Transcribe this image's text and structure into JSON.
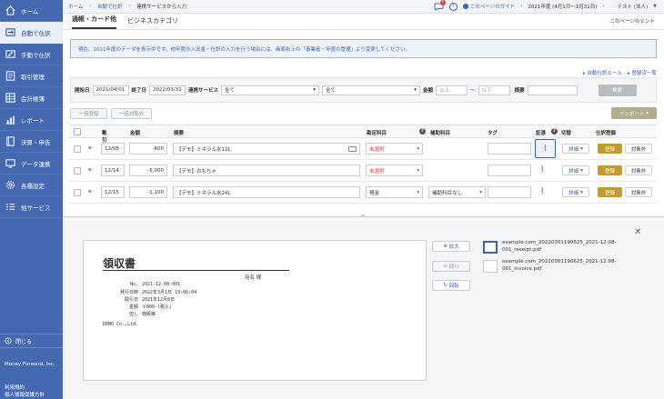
{
  "sidebar": {
    "items": [
      {
        "label": "ホーム",
        "icon": "home-icon"
      },
      {
        "label": "自動で仕訳",
        "icon": "auto-journal-icon",
        "active": true
      },
      {
        "label": "手動で仕訳",
        "icon": "manual-journal-icon"
      },
      {
        "label": "取引管理",
        "icon": "transaction-icon"
      },
      {
        "label": "会計帳簿",
        "icon": "ledger-icon"
      },
      {
        "label": "レポート",
        "icon": "report-icon"
      },
      {
        "label": "決算・申告",
        "icon": "settlement-icon"
      },
      {
        "label": "データ連携",
        "icon": "data-link-icon"
      },
      {
        "label": "各種設定",
        "icon": "settings-icon"
      },
      {
        "label": "他サービス",
        "icon": "other-services-icon"
      }
    ],
    "close_label": "閉じる",
    "company": "Money Forward, Inc.",
    "terms": "利用規約",
    "privacy": "個人情報保護方針"
  },
  "topbar": {
    "crumbs": [
      "ホーム",
      "自動で仕訳",
      "連携サービスから入力"
    ],
    "notification_count": "1",
    "guide_label": "このページのガイド",
    "fiscal_year": "2021年度 (4月1日〜3月31日)",
    "user": "テスト (法人)"
  },
  "tabs": [
    {
      "label": "通帳・カード他",
      "active": true
    },
    {
      "label": "ビジネスカテゴリ",
      "active": false
    }
  ],
  "tab_hint": "このページのヒント",
  "notice": "現在、2021年度のデータを表示中です。他年度の入出金・仕訳の入力を行う場合には、画面右上の「事業者・年度の管理」より変更してください。",
  "links": {
    "auto_rule": "自動仕訳ルール",
    "registered": "登録済一覧"
  },
  "filter": {
    "start_label": "開始日",
    "start_value": "2021/04/01",
    "end_label": "終了日",
    "end_value": "2022/03/31",
    "service_label": "連携サービス",
    "service_value": "全て",
    "service2_value": "全て",
    "amount_label": "金額",
    "amount_min_ph": "以上",
    "amount_tilde": "〜",
    "amount_max_ph": "以下",
    "memo_label": "摘要",
    "search_button": "検索"
  },
  "actions": {
    "bulk_register": "一括登録",
    "bulk_exclude": "一括対象外",
    "import": "インポート"
  },
  "table": {
    "headers": {
      "date": "取引日",
      "sort_arrow": "▲",
      "amount": "金額",
      "memo": "摘要",
      "account": "勘定科目",
      "sub_account": "補助科目",
      "tag": "タグ",
      "evidence": "証憑",
      "switch": "切替",
      "register": "仕訳登録",
      "help": "?"
    },
    "rows": [
      {
        "date": "12/08",
        "amount": "-600",
        "memo": "【デモ】ミネラル水12L",
        "account": "未選択",
        "account_unselected": true,
        "sub_account": "",
        "detail": "詳細",
        "register": "登録",
        "exclude": "対象外"
      },
      {
        "date": "12/14",
        "amount": "-5,000",
        "memo": "【デモ】おもちゃ",
        "account": "未選択",
        "account_unselected": true,
        "sub_account": "",
        "detail": "詳細",
        "register": "登録",
        "exclude": "対象外"
      },
      {
        "date": "12/15",
        "amount": "-1,100",
        "memo": "【デモ】ミネラル水24L",
        "account": "現金",
        "account_unselected": false,
        "sub_account": "補助科目なし",
        "detail": "詳細",
        "register": "登録",
        "exclude": "対象外"
      }
    ]
  },
  "receipt": {
    "title": "領収書",
    "to": "宛名 様",
    "lines": [
      {
        "k": "No.",
        "v": "2021-12-08-001"
      },
      {
        "k": "発行日時",
        "v": "2022年3月1日 19:06:04"
      },
      {
        "k": "取引日",
        "v": "2021年12月8日"
      },
      {
        "k": "金額",
        "v": "￥600-(税込)"
      },
      {
        "k": "但し",
        "v": "物販等"
      }
    ],
    "issuer": "DEMO Co.,Ltd."
  },
  "preview": {
    "zoom_in": "拡大",
    "zoom_out": "縮小",
    "rotate": "回転",
    "files": [
      "example.com_20220301190625_2021-12-08-001_receipt.pdf",
      "example.com_20220301190625_2021-12-08-001_invoice.pdf"
    ]
  },
  "colors": {
    "sidebar": "#4569b0",
    "accent": "#3a62b0",
    "gold": "#c39a2e",
    "red": "#d0443a"
  }
}
